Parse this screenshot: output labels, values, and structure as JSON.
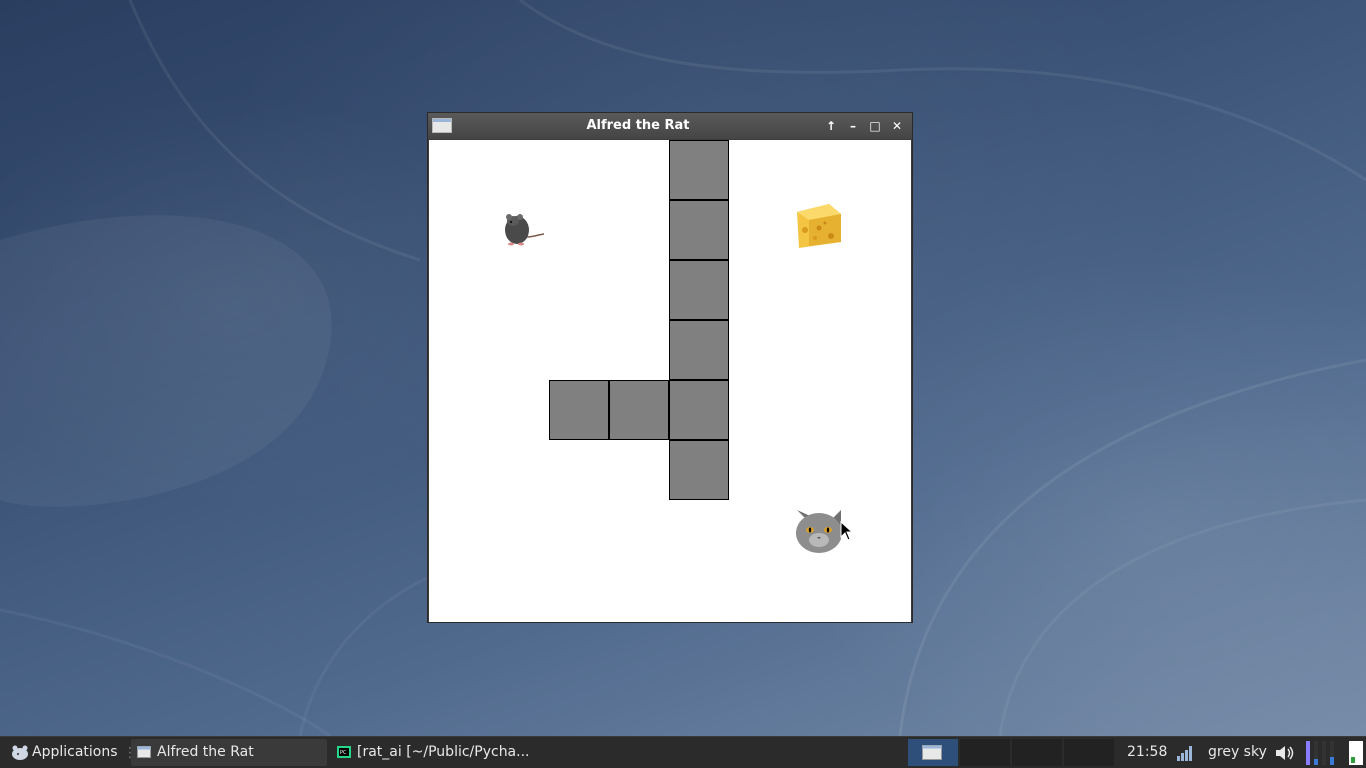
{
  "window": {
    "title": "Alfred the Rat",
    "buttons": {
      "shade": "↑",
      "minimize": "–",
      "maximize": "□",
      "close": "✕"
    }
  },
  "game": {
    "grid_size": 8,
    "obstacles": [
      {
        "col": 4,
        "row": 0
      },
      {
        "col": 4,
        "row": 1
      },
      {
        "col": 4,
        "row": 2
      },
      {
        "col": 4,
        "row": 3
      },
      {
        "col": 2,
        "row": 4
      },
      {
        "col": 3,
        "row": 4
      },
      {
        "col": 4,
        "row": 4
      },
      {
        "col": 4,
        "row": 5
      }
    ],
    "rat": {
      "col": 1,
      "row": 1
    },
    "cheese": {
      "col": 6,
      "row": 1
    },
    "cat": {
      "col": 6,
      "row": 6
    },
    "colors": {
      "obstacle": "#808080",
      "background": "#ffffff"
    }
  },
  "taskbar": {
    "applications_label": "Applications",
    "tasks": [
      {
        "label": "Alfred the Rat",
        "active": true
      },
      {
        "label": "[rat_ai [~/Public/Pycha...",
        "active": false
      }
    ],
    "clock": "21:58",
    "weather": "grey sky"
  }
}
